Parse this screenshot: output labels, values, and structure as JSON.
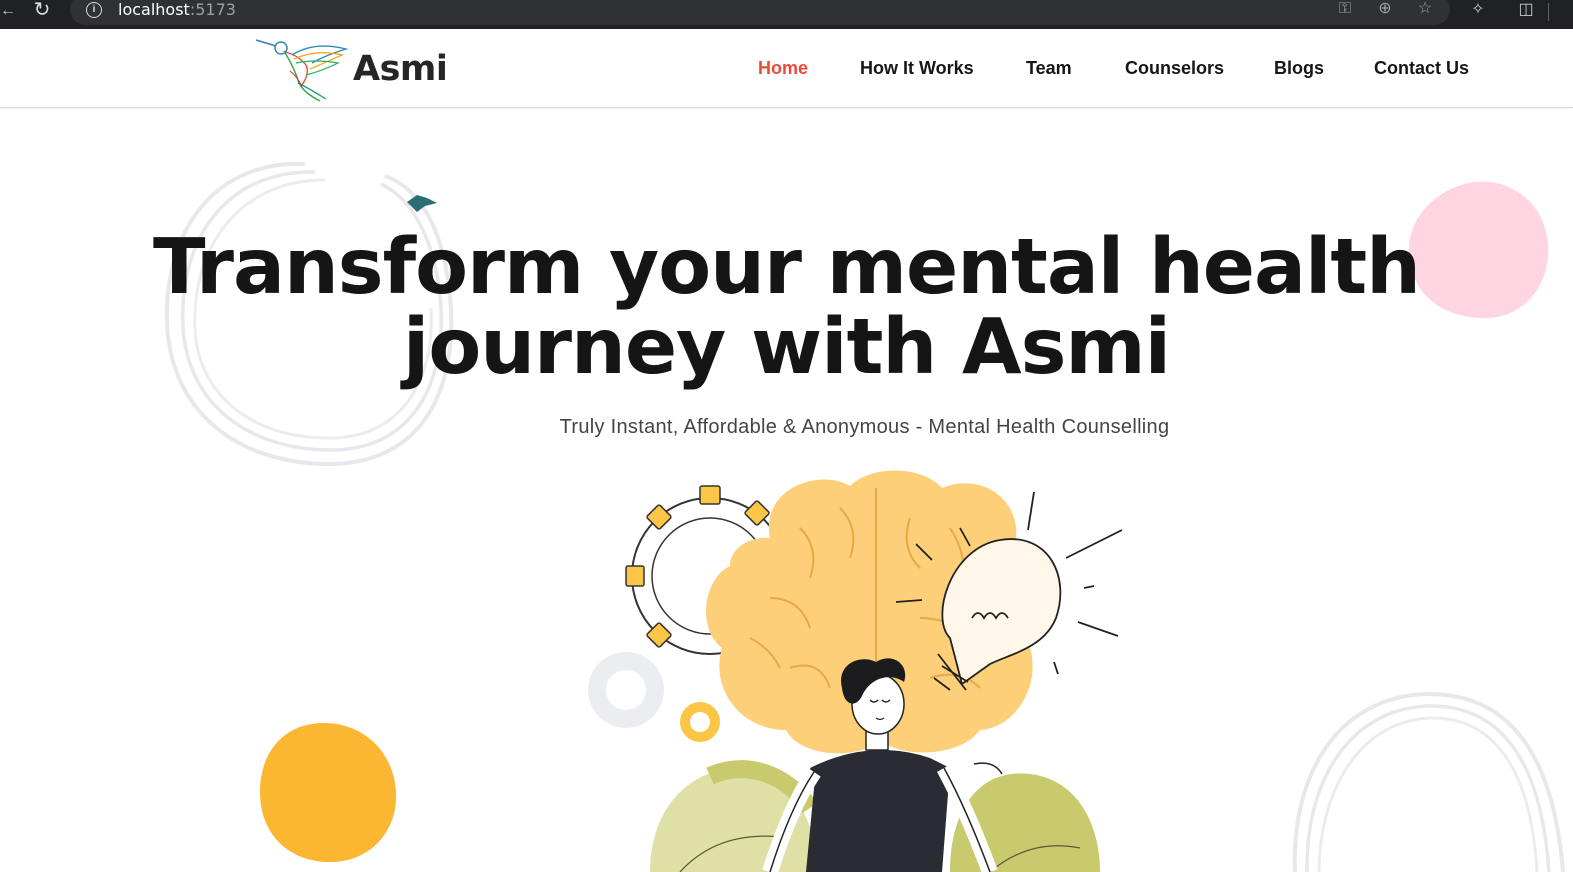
{
  "browser": {
    "url_host": "localhost",
    "url_port": ":5173",
    "icons": [
      "back-icon",
      "reload-icon",
      "info-icon",
      "key-icon",
      "zoom-icon",
      "star-icon",
      "extensions-icon",
      "split-view-icon"
    ]
  },
  "nav": {
    "brand": "Asmi",
    "links": [
      {
        "label": "Home",
        "active": true
      },
      {
        "label": "How It Works",
        "active": false
      },
      {
        "label": "Team",
        "active": false
      },
      {
        "label": "Counselors",
        "active": false
      },
      {
        "label": "Blogs",
        "active": false
      },
      {
        "label": "Contact Us",
        "active": false
      }
    ]
  },
  "hero": {
    "title_line1": "Transform your mental health",
    "title_line2": "journey with Asmi",
    "subtitle": "Truly Instant, Affordable & Anonymous - Mental Health Counselling"
  },
  "colors": {
    "accent": "#ec4a36",
    "blob_yellow": "#fbb731",
    "blob_pink": "#ffd5e1",
    "brain": "#fdcf78",
    "leaf": "#dfe0a6"
  }
}
